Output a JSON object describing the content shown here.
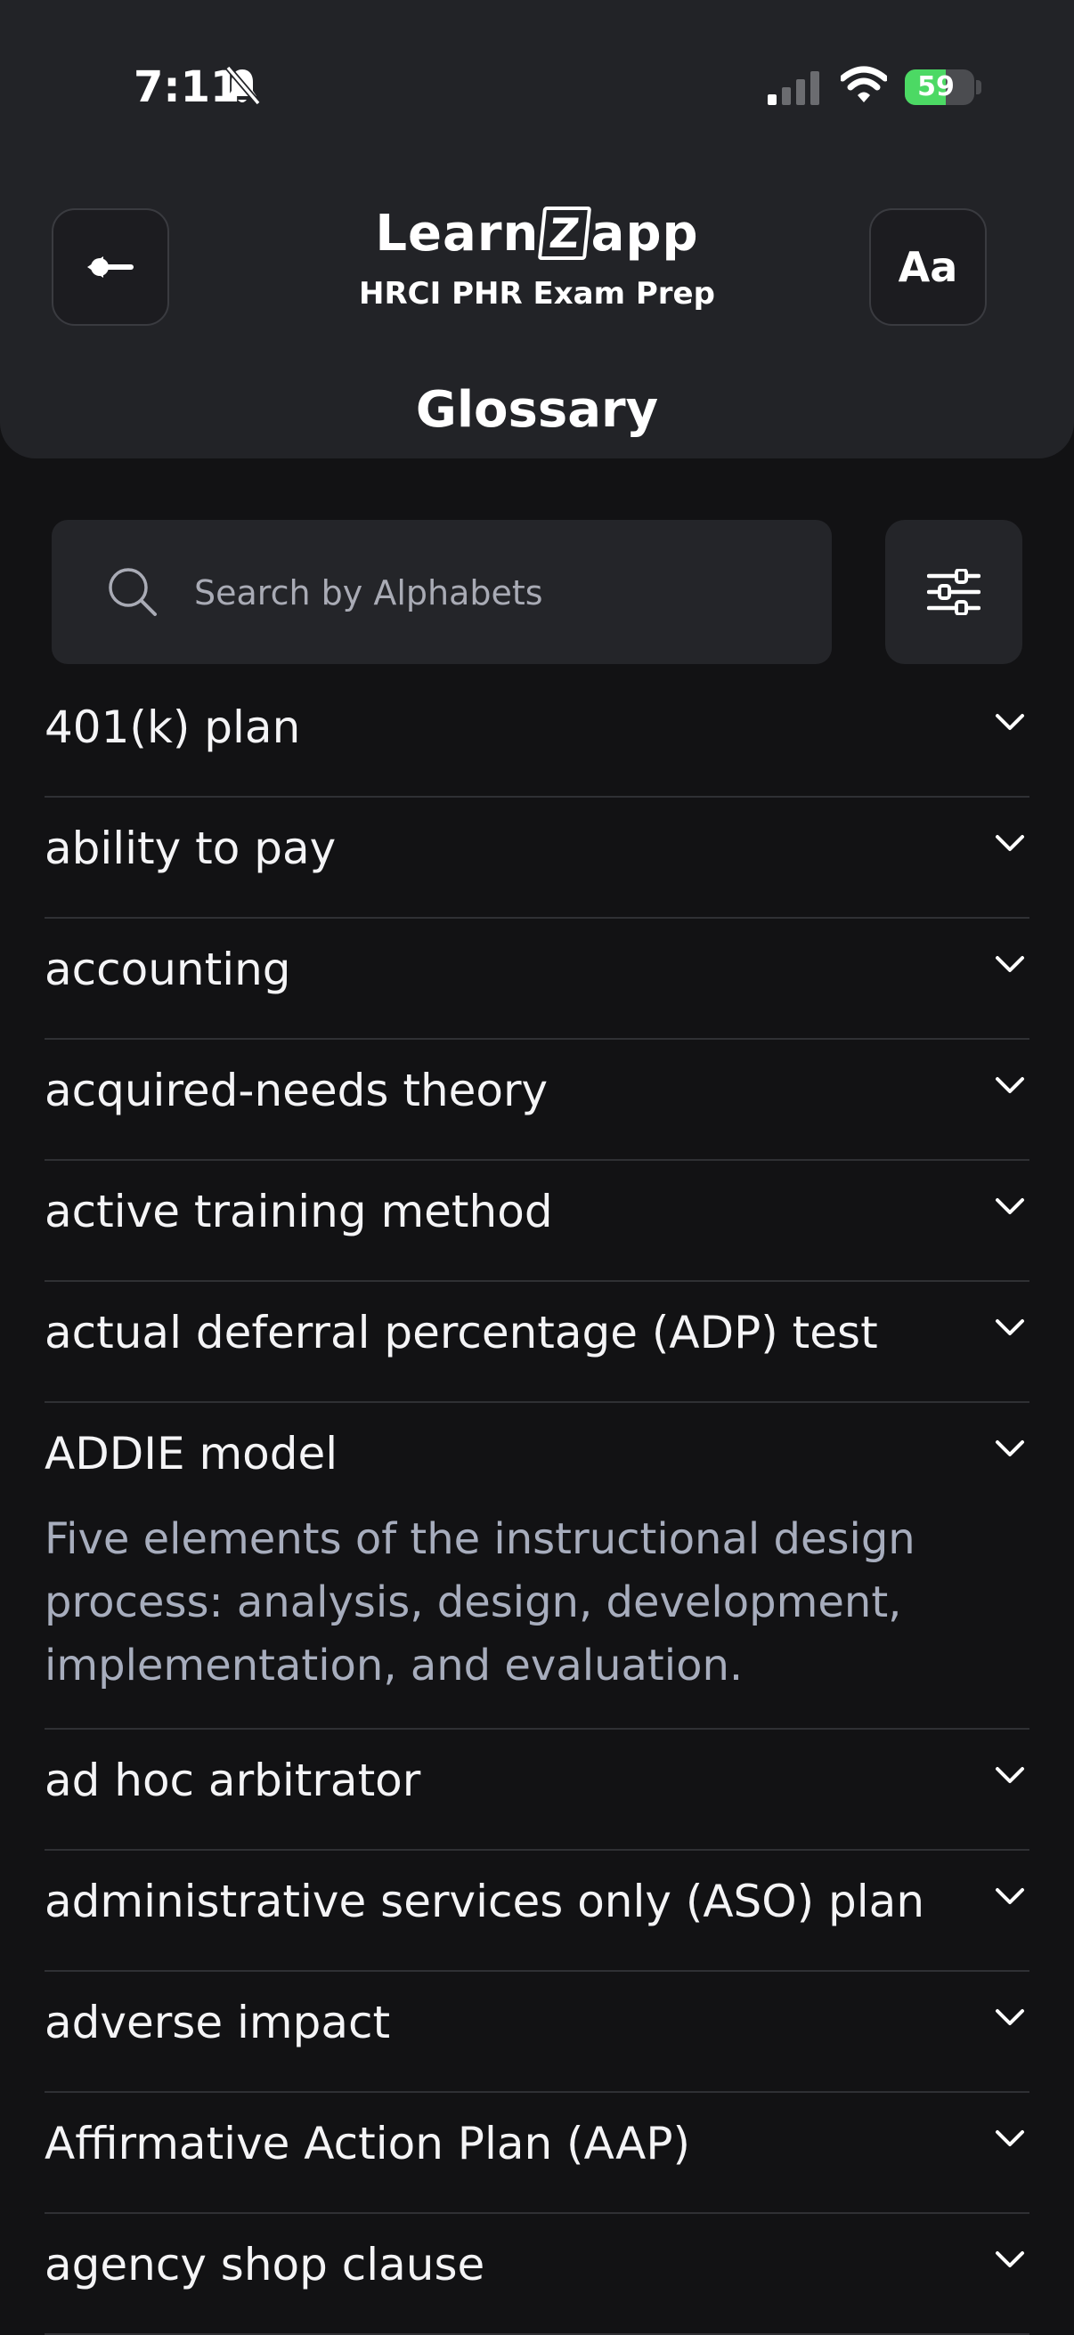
{
  "status_bar": {
    "time": "7:11",
    "battery": "59",
    "battery_level": 0.59,
    "battery_color": "#4cd964"
  },
  "header": {
    "back_icon": "arrow-left-icon",
    "logo": {
      "pre": "Learn",
      "mid": "Z",
      "post": "app"
    },
    "subtitle": "HRCI PHR  Exam Prep",
    "font_button_label": "Aa",
    "title": "Glossary"
  },
  "search": {
    "placeholder": "Search by Alphabets",
    "value": "",
    "icon": "search-icon"
  },
  "filter": {
    "icon": "sliders-icon"
  },
  "glossary": [
    {
      "term": "401(k) plan",
      "definition": ""
    },
    {
      "term": "ability to pay",
      "definition": ""
    },
    {
      "term": "accounting",
      "definition": ""
    },
    {
      "term": "acquired-needs theory",
      "definition": ""
    },
    {
      "term": "active training method",
      "definition": ""
    },
    {
      "term": "actual deferral percentage (ADP) test",
      "definition": ""
    },
    {
      "term": "ADDIE model",
      "definition": "Five elements of the instructional design process: analysis, design, development, implementation, and evaluation."
    },
    {
      "term": "ad hoc arbitrator",
      "definition": ""
    },
    {
      "term": "administrative services only (ASO) plan",
      "definition": ""
    },
    {
      "term": "adverse impact",
      "definition": ""
    },
    {
      "term": "Affirmative Action Plan (AAP)",
      "definition": ""
    },
    {
      "term": "agency shop clause",
      "definition": ""
    }
  ],
  "colors": {
    "background": "#121214",
    "header": "#222327",
    "definition_text": "#a7adbd"
  }
}
